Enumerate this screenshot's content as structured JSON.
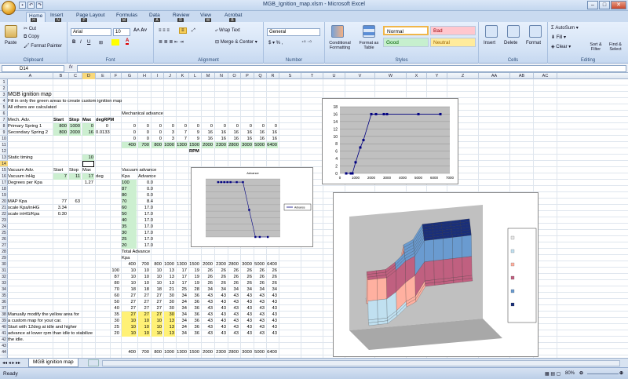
{
  "window": {
    "title": "MGB_Ignition_map.xlsm - Microsoft Excel",
    "qat_icons": [
      "save-icon",
      "undo-icon",
      "redo-icon"
    ],
    "controls": [
      "minimize",
      "maximize",
      "close"
    ]
  },
  "tabs": [
    {
      "label": "Home",
      "key": "H"
    },
    {
      "label": "Insert",
      "key": "N"
    },
    {
      "label": "Page Layout",
      "key": "P"
    },
    {
      "label": "Formulas",
      "key": "M"
    },
    {
      "label": "Data",
      "key": "A"
    },
    {
      "label": "Review",
      "key": "R"
    },
    {
      "label": "View",
      "key": "W"
    },
    {
      "label": "Acrobat",
      "key": "B"
    }
  ],
  "ribbon": {
    "clipboard": {
      "label": "Clipboard",
      "paste": "Paste",
      "cut": "Cut",
      "copy": "Copy",
      "format_painter": "Format Painter"
    },
    "font": {
      "label": "Font",
      "name": "Arial",
      "size": "10"
    },
    "alignment": {
      "label": "Alignment",
      "wrap": "Wrap Text",
      "merge": "Merge & Center"
    },
    "number": {
      "label": "Number",
      "format": "General"
    },
    "styles": {
      "label": "Styles",
      "cond": "Conditional Formatting",
      "table": "Format as Table",
      "normal": "Normal",
      "bad": "Bad",
      "good": "Good",
      "neutral": "Neutral",
      "colors": {
        "normal": "#ffffff",
        "bad": "#ffc7ce",
        "good": "#c6efce",
        "neutral": "#ffeb9c"
      }
    },
    "cells": {
      "label": "Cells",
      "insert": "Insert",
      "delete": "Delete",
      "format": "Format"
    },
    "editing": {
      "label": "Editing",
      "autosum": "AutoSum",
      "fill": "Fill",
      "clear": "Clear",
      "sort": "Sort & Filter",
      "find": "Find & Select"
    }
  },
  "formula_bar": {
    "name_box": "D14",
    "fx": "fx",
    "value": ""
  },
  "columns": [
    "A",
    "B",
    "C",
    "D",
    "E",
    "F",
    "G",
    "H",
    "I",
    "J",
    "K",
    "L",
    "M",
    "N",
    "O",
    "P",
    "Q",
    "R",
    "S",
    "T",
    "U",
    "V",
    "W",
    "X",
    "Y",
    "Z",
    "AA",
    "AB",
    "AC"
  ],
  "selected_col": "D",
  "selected_row": 14,
  "sheet": {
    "title": "MGB ignition map",
    "note1": "Fill in only the green areas to create custom ignition map",
    "note2": "All others are calculated",
    "mech_hdr": [
      "Mech. Adv.",
      "Start",
      "Stop",
      "Max",
      "degRPM"
    ],
    "mech_rows": [
      [
        "Primary Spring 1",
        "800",
        "1000",
        "0",
        "0"
      ],
      [
        "Secondary Spring 2",
        "800",
        "2000",
        "16",
        "0.0133"
      ]
    ],
    "mech_title": "Mechanical advance",
    "mech_table": [
      [
        "0",
        "0",
        "0",
        "0",
        "0",
        "0",
        "0",
        "0",
        "0",
        "0",
        "0",
        "0"
      ],
      [
        "0",
        "0",
        "0",
        "3",
        "7",
        "9",
        "16",
        "16",
        "16",
        "16",
        "16",
        "16"
      ],
      [
        "0",
        "0",
        "0",
        "3",
        "7",
        "9",
        "16",
        "16",
        "16",
        "16",
        "16",
        "16"
      ]
    ],
    "rpm": [
      "400",
      "700",
      "800",
      "1000",
      "1300",
      "1500",
      "2000",
      "2300",
      "2800",
      "3000",
      "5000",
      "6400"
    ],
    "rpm_label": "RPM",
    "static_label": "Static timing",
    "static_val": "10",
    "vac_hdr": [
      "Vacuum Adv.",
      "Start",
      "Stop",
      "Max"
    ],
    "vac_row1": [
      "Vacuum inHg",
      "7",
      "11",
      "17",
      "deg"
    ],
    "vac_row2": [
      "Degrees per Kpa",
      "1.27"
    ],
    "map_row": [
      "MAP Kpa",
      "77",
      "63"
    ],
    "scale1": [
      "scale Kpa/inHG",
      "3.34"
    ],
    "scale2": [
      "scale inHG/Kpa",
      "0.30"
    ],
    "vac_title": "Vacuum advance",
    "vac_cols": [
      "Kpa",
      "Advance"
    ],
    "vac_table": [
      [
        "100",
        "0.0"
      ],
      [
        "87",
        "0.0"
      ],
      [
        "80",
        "0.0"
      ],
      [
        "70",
        "8.4"
      ],
      [
        "60",
        "17.0"
      ],
      [
        "50",
        "17.0"
      ],
      [
        "40",
        "17.0"
      ],
      [
        "35",
        "17.0"
      ],
      [
        "30",
        "17.0"
      ],
      [
        "25",
        "17.0"
      ],
      [
        "20",
        "17.0"
      ]
    ],
    "total_title": "Total Advance",
    "total_kpa": "Kpa",
    "total_kpas": [
      "100",
      "87",
      "80",
      "70",
      "60",
      "50",
      "40",
      "35",
      "30",
      "25",
      "20"
    ],
    "total_table": [
      [
        "10",
        "10",
        "10",
        "13",
        "17",
        "19",
        "26",
        "26",
        "26",
        "26",
        "26",
        "26"
      ],
      [
        "10",
        "10",
        "10",
        "13",
        "17",
        "19",
        "26",
        "26",
        "26",
        "26",
        "26",
        "26"
      ],
      [
        "10",
        "10",
        "10",
        "13",
        "17",
        "19",
        "26",
        "26",
        "26",
        "26",
        "26",
        "26"
      ],
      [
        "18",
        "18",
        "18",
        "21",
        "25",
        "28",
        "34",
        "34",
        "34",
        "34",
        "34",
        "34"
      ],
      [
        "27",
        "27",
        "27",
        "30",
        "34",
        "36",
        "43",
        "43",
        "43",
        "43",
        "43",
        "43"
      ],
      [
        "27",
        "27",
        "27",
        "30",
        "34",
        "36",
        "43",
        "43",
        "43",
        "43",
        "43",
        "43"
      ],
      [
        "27",
        "27",
        "27",
        "30",
        "34",
        "36",
        "43",
        "43",
        "43",
        "43",
        "43",
        "43"
      ],
      [
        "27",
        "27",
        "27",
        "30",
        "34",
        "36",
        "43",
        "43",
        "43",
        "43",
        "43",
        "43"
      ],
      [
        "10",
        "10",
        "10",
        "13",
        "34",
        "36",
        "43",
        "43",
        "43",
        "43",
        "43",
        "43"
      ],
      [
        "10",
        "10",
        "10",
        "13",
        "34",
        "36",
        "43",
        "43",
        "43",
        "43",
        "43",
        "43"
      ],
      [
        "10",
        "10",
        "10",
        "13",
        "34",
        "36",
        "43",
        "43",
        "43",
        "43",
        "43",
        "43"
      ]
    ],
    "manual": [
      "Manually modify the yellow area for",
      "a custom map for your car.",
      "Start with 12deg at idle and higher",
      "advance at lower rpm than idle to stabilize",
      "the idle."
    ]
  },
  "charts": {
    "mech_chart": {
      "x": [
        400,
        700,
        800,
        1000,
        1300,
        1500,
        2000,
        2300,
        2800,
        3000,
        5000,
        6400
      ],
      "y": [
        0,
        0,
        0,
        3,
        7,
        9,
        16,
        16,
        16,
        16,
        16,
        16
      ],
      "xlim": [
        0,
        7000
      ],
      "ylim": [
        0,
        18
      ],
      "yticks": [
        "0",
        "2",
        "4",
        "6",
        "8",
        "10",
        "12",
        "14",
        "16",
        "18"
      ],
      "xticks": [
        "0",
        "1000",
        "2000",
        "3000",
        "4000",
        "5000",
        "6000",
        "7000"
      ]
    },
    "vac_chart": {
      "title": "Advance",
      "legend": "Advance"
    },
    "surface_colors": [
      "#e8e8e8",
      "#c0e0f0",
      "#ffb0a0",
      "#c06080",
      "#6a9bd0",
      "#1a2f7a"
    ]
  },
  "sheet_tab": "MGB ignition map",
  "status": {
    "ready": "Ready",
    "zoom": "80%"
  }
}
